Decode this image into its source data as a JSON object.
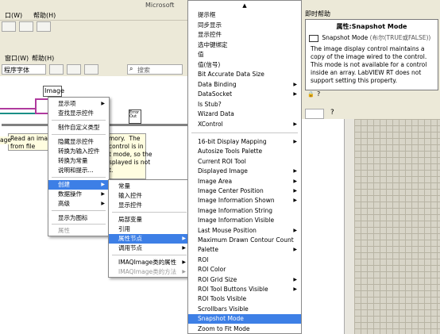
{
  "back_window": {
    "menu_help": "帮助(H)",
    "menu_window": "窗口(W)",
    "menu_help2": "帮助(H)",
    "font_label": "程序字体",
    "search_placeholder": "搜索",
    "title_partial": "Microsoft"
  },
  "diagram": {
    "image_label": "Image",
    "error_label": "Error Out",
    "comment_text": "Read an ima\nfrom file",
    "right_note": "mory.  The\ncontrol is in\nt mode, so the\nsplayed is not\nt.",
    "left_word": "age"
  },
  "context_menu": {
    "items": [
      {
        "label": "显示项",
        "arrow": true
      },
      {
        "label": "查找显示控件"
      },
      {
        "label": "制作自定义类型"
      },
      {
        "label": "隐藏显示控件"
      },
      {
        "label": "转换为输入控件"
      },
      {
        "label": "转换为常量"
      },
      {
        "label": "说明和提示..."
      },
      {
        "label": "创建",
        "arrow": true,
        "selected": true
      },
      {
        "label": "数据操作",
        "arrow": true
      },
      {
        "label": "高级",
        "arrow": true
      },
      {
        "label": "显示为图标"
      },
      {
        "label": "属性",
        "disabled": true
      }
    ]
  },
  "create_menu": {
    "items": [
      {
        "label": "常量"
      },
      {
        "label": "输入控件"
      },
      {
        "label": "显示控件"
      },
      {
        "label": "局部变量"
      },
      {
        "label": "引用"
      },
      {
        "label": "属性节点",
        "arrow": true,
        "selected": true
      },
      {
        "label": "调用节点",
        "arrow": true
      },
      {
        "label": "IMAQImage类的属性",
        "arrow": true
      },
      {
        "label": "IMAQImage类的方法",
        "arrow": true,
        "disabled": true
      }
    ]
  },
  "property_menu": {
    "top_items": [
      "提示框",
      "同步显示",
      "显示控件",
      "选中键绑定",
      "值",
      "值(信号)",
      "Bit Accurate Data Size",
      "Data Binding",
      "DataSocket",
      "Is Stub?",
      "Wizard Data",
      "XControl"
    ],
    "top_arrows": [
      false,
      false,
      false,
      false,
      false,
      false,
      false,
      true,
      true,
      false,
      false,
      true
    ],
    "bottom_items": [
      "16-bit Display Mapping",
      "Autosize Tools Palette",
      "Current ROI Tool",
      "Displayed Image",
      "Image Area",
      "Image Center Position",
      "Image Information Shown",
      "Image Information String",
      "Image Information Visible",
      "Last Mouse Position",
      "Maximum Drawn Contour Count",
      "Palette",
      "ROI",
      "ROI Color",
      "ROI Grid Size",
      "ROI Tool Buttons Visible",
      "ROI Tools Visible",
      "Scrollbars Visible",
      "Snapshot Mode",
      "Zoom to Fit Mode"
    ],
    "bottom_arrows": [
      true,
      false,
      false,
      true,
      true,
      true,
      true,
      false,
      false,
      true,
      false,
      true,
      false,
      false,
      true,
      true,
      false,
      false,
      false,
      false
    ],
    "selected": "Snapshot Mode"
  },
  "help_window": {
    "title": "即时帮助",
    "heading": "属性:Snapshot Mode",
    "subtitle": "Snapshot Mode",
    "subtitle_type": "(布尔(TRUE或FALSE))",
    "body": "The image display control maintains a copy of the image wired to the control. This mode is not available for a control inside an array. LabVIEW RT does not support setting this property."
  },
  "colors": {
    "selection": "#3d7fe6",
    "desktop": "#6f8fae",
    "menu_bg": "#ffffff"
  }
}
